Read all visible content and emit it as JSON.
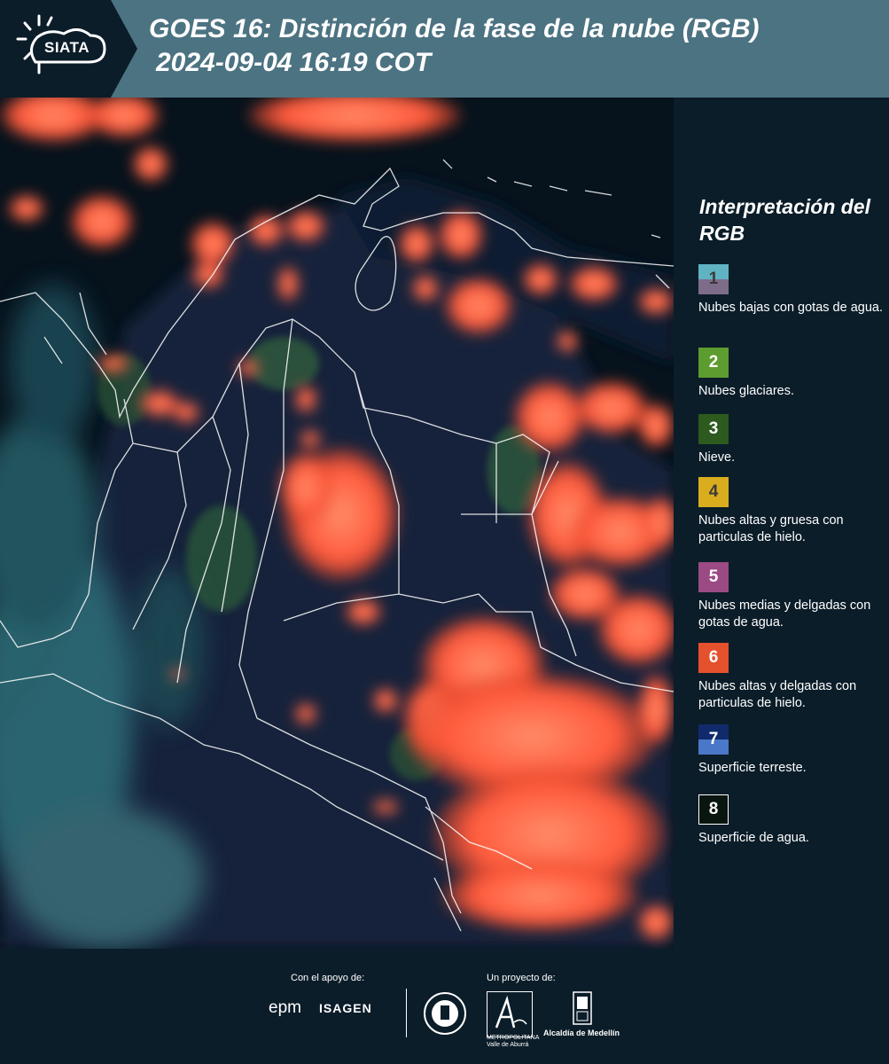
{
  "header": {
    "logo_text": "SIATA",
    "title_line1": "GOES 16: Distinción de la fase de la nube (RGB)",
    "title_line2": "2024-09-04 16:19 COT"
  },
  "legend": {
    "title": "Interpretación del RGB",
    "items": [
      {
        "number": "1",
        "label": "Nubes bajas con gotas de agua.",
        "color_top": "#5fb3c3",
        "color_bottom": "#7d6d8a",
        "num_color": "#3a3a3a"
      },
      {
        "number": "2",
        "label": "Nubes glaciares.",
        "color_top": "#5d9c2e",
        "color_bottom": "#5d9c2e",
        "num_color": "#ffffff"
      },
      {
        "number": "3",
        "label": "Nieve.",
        "color_top": "#2d5a1f",
        "color_bottom": "#2d5a1f",
        "num_color": "#ffffff"
      },
      {
        "number": "4",
        "label": "Nubes altas y gruesa con particulas de hielo.",
        "color_top": "#d9ad1e",
        "color_bottom": "#d9ad1e",
        "num_color": "#3a3a3a"
      },
      {
        "number": "5",
        "label": "Nubes medias y delgadas con gotas de agua.",
        "color_top": "#9b4a83",
        "color_bottom": "#9b4a83",
        "num_color": "#ffffff"
      },
      {
        "number": "6",
        "label": "Nubes altas y delgadas con particulas de hielo.",
        "color_top": "#e4512c",
        "color_bottom": "#e4512c",
        "num_color": "#ffffff"
      },
      {
        "number": "7",
        "label": "Superficie terreste.",
        "color_top": "#102a6b",
        "color_bottom": "#4a77c8",
        "num_color": "#ffffff"
      },
      {
        "number": "8",
        "label": "Superficie de agua.",
        "color_top": "#08160f",
        "color_bottom": "#08160f",
        "num_color": "#ffffff"
      }
    ]
  },
  "footer": {
    "support_label": "Con el apoyo de:",
    "project_label": "Un proyecto de:",
    "epm": "epm",
    "isagen": "ISAGEN",
    "area_text": "METROPOLITANA Valle de Aburrá",
    "alcaldia": "Alcaldía de Medellín"
  },
  "colors": {
    "header_bg": "#4c7382",
    "panel_bg": "#0b1d29",
    "cloud_ice": "#ff5a3c",
    "cloud_ice_bright": "#ff7a55"
  }
}
